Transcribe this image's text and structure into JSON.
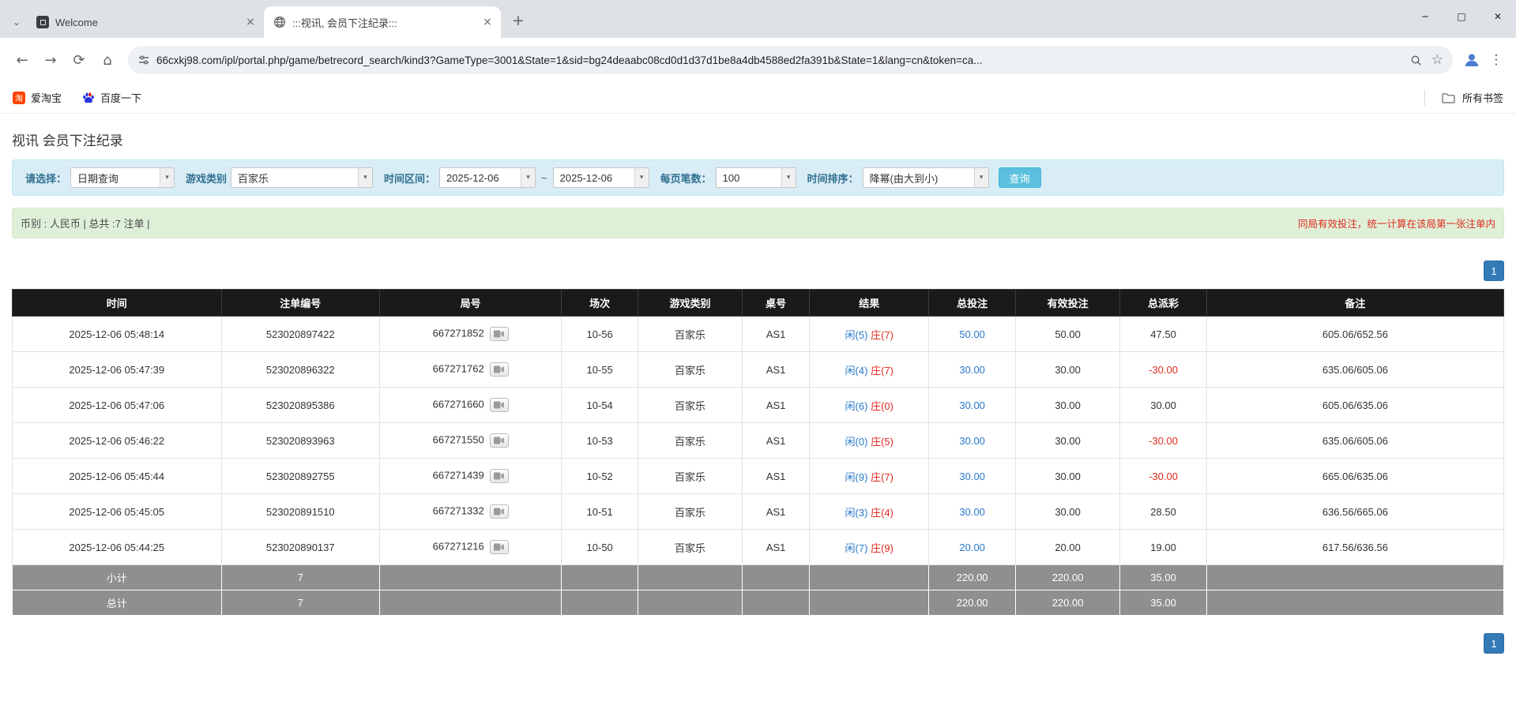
{
  "browser": {
    "tabs": [
      {
        "title": "Welcome"
      },
      {
        "title": ":::视讯, 会员下注纪录:::"
      }
    ],
    "url": "66cxkj98.com/ipl/portal.php/game/betrecord_search/kind3?GameType=3001&State=1&sid=bg24deaabc08cd0d1d37d1be8a4db4588ed2fa391b&State=1&lang=cn&token=ca...",
    "bookmarks": {
      "items": [
        {
          "label": "爱淘宝"
        },
        {
          "label": "百度一下"
        }
      ],
      "all_bookmarks": "所有书签"
    },
    "icons": {
      "tab_list_chevron": "⌄",
      "close_tab": "×",
      "new_tab": "+",
      "minimize": "─",
      "maximize": "□",
      "close_window": "✕",
      "back": "←",
      "forward": "→",
      "reload": "⟳",
      "home": "⌂",
      "bookmark_star": "☆",
      "menu": "⋮",
      "dropdown_arrow": "▾",
      "taobao": "淘"
    }
  },
  "page": {
    "title": "视讯 会员下注纪录",
    "filters": {
      "select_label": "请选择：",
      "select_value": "日期查询",
      "game_type_label": "游戏类别",
      "game_type_value": "百家乐",
      "date_range_label": "时间区间：",
      "date_from": "2025-12-06",
      "range_separator": "~",
      "date_to": "2025-12-06",
      "per_page_label": "每页笔数：",
      "per_page_value": "100",
      "sort_label": "时间排序：",
      "sort_value": "降幂(由大到小)",
      "search_button": "查询"
    },
    "info_bar": {
      "summary": "币别 : 人民币 | 总共 :7 注单 |",
      "notice": "同局有效投注，统一计算在该局第一张注单内"
    },
    "pagination": {
      "page": "1"
    },
    "table": {
      "headers": [
        "时间",
        "注单编号",
        "局号",
        "场次",
        "游戏类别",
        "桌号",
        "结果",
        "总投注",
        "有效投注",
        "总派彩",
        "备注"
      ],
      "rows": [
        {
          "time": "2025-12-06 05:48:14",
          "bet_id": "523020897422",
          "round": "667271852",
          "session": "10-56",
          "game": "百家乐",
          "table": "AS1",
          "player": "闲(5)",
          "banker": "庄(7)",
          "total_bet": "50.00",
          "valid_bet": "50.00",
          "payout": "47.50",
          "note": "605.06/652.56"
        },
        {
          "time": "2025-12-06 05:47:39",
          "bet_id": "523020896322",
          "round": "667271762",
          "session": "10-55",
          "game": "百家乐",
          "table": "AS1",
          "player": "闲(4)",
          "banker": "庄(7)",
          "total_bet": "30.00",
          "valid_bet": "30.00",
          "payout": "-30.00",
          "note": "635.06/605.06"
        },
        {
          "time": "2025-12-06 05:47:06",
          "bet_id": "523020895386",
          "round": "667271660",
          "session": "10-54",
          "game": "百家乐",
          "table": "AS1",
          "player": "闲(6)",
          "banker": "庄(0)",
          "total_bet": "30.00",
          "valid_bet": "30.00",
          "payout": "30.00",
          "note": "605.06/635.06"
        },
        {
          "time": "2025-12-06 05:46:22",
          "bet_id": "523020893963",
          "round": "667271550",
          "session": "10-53",
          "game": "百家乐",
          "table": "AS1",
          "player": "闲(0)",
          "banker": "庄(5)",
          "total_bet": "30.00",
          "valid_bet": "30.00",
          "payout": "-30.00",
          "note": "635.06/605.06"
        },
        {
          "time": "2025-12-06 05:45:44",
          "bet_id": "523020892755",
          "round": "667271439",
          "session": "10-52",
          "game": "百家乐",
          "table": "AS1",
          "player": "闲(9)",
          "banker": "庄(7)",
          "total_bet": "30.00",
          "valid_bet": "30.00",
          "payout": "-30.00",
          "note": "665.06/635.06"
        },
        {
          "time": "2025-12-06 05:45:05",
          "bet_id": "523020891510",
          "round": "667271332",
          "session": "10-51",
          "game": "百家乐",
          "table": "AS1",
          "player": "闲(3)",
          "banker": "庄(4)",
          "total_bet": "30.00",
          "valid_bet": "30.00",
          "payout": "28.50",
          "note": "636.56/665.06"
        },
        {
          "time": "2025-12-06 05:44:25",
          "bet_id": "523020890137",
          "round": "667271216",
          "session": "10-50",
          "game": "百家乐",
          "table": "AS1",
          "player": "闲(7)",
          "banker": "庄(9)",
          "total_bet": "20.00",
          "valid_bet": "20.00",
          "payout": "19.00",
          "note": "617.56/636.56"
        }
      ],
      "subtotal": {
        "label": "小计",
        "count": "7",
        "total_bet": "220.00",
        "valid_bet": "220.00",
        "payout": "35.00"
      },
      "grand_total": {
        "label": "总计",
        "count": "7",
        "total_bet": "220.00",
        "valid_bet": "220.00",
        "payout": "35.00"
      }
    }
  }
}
